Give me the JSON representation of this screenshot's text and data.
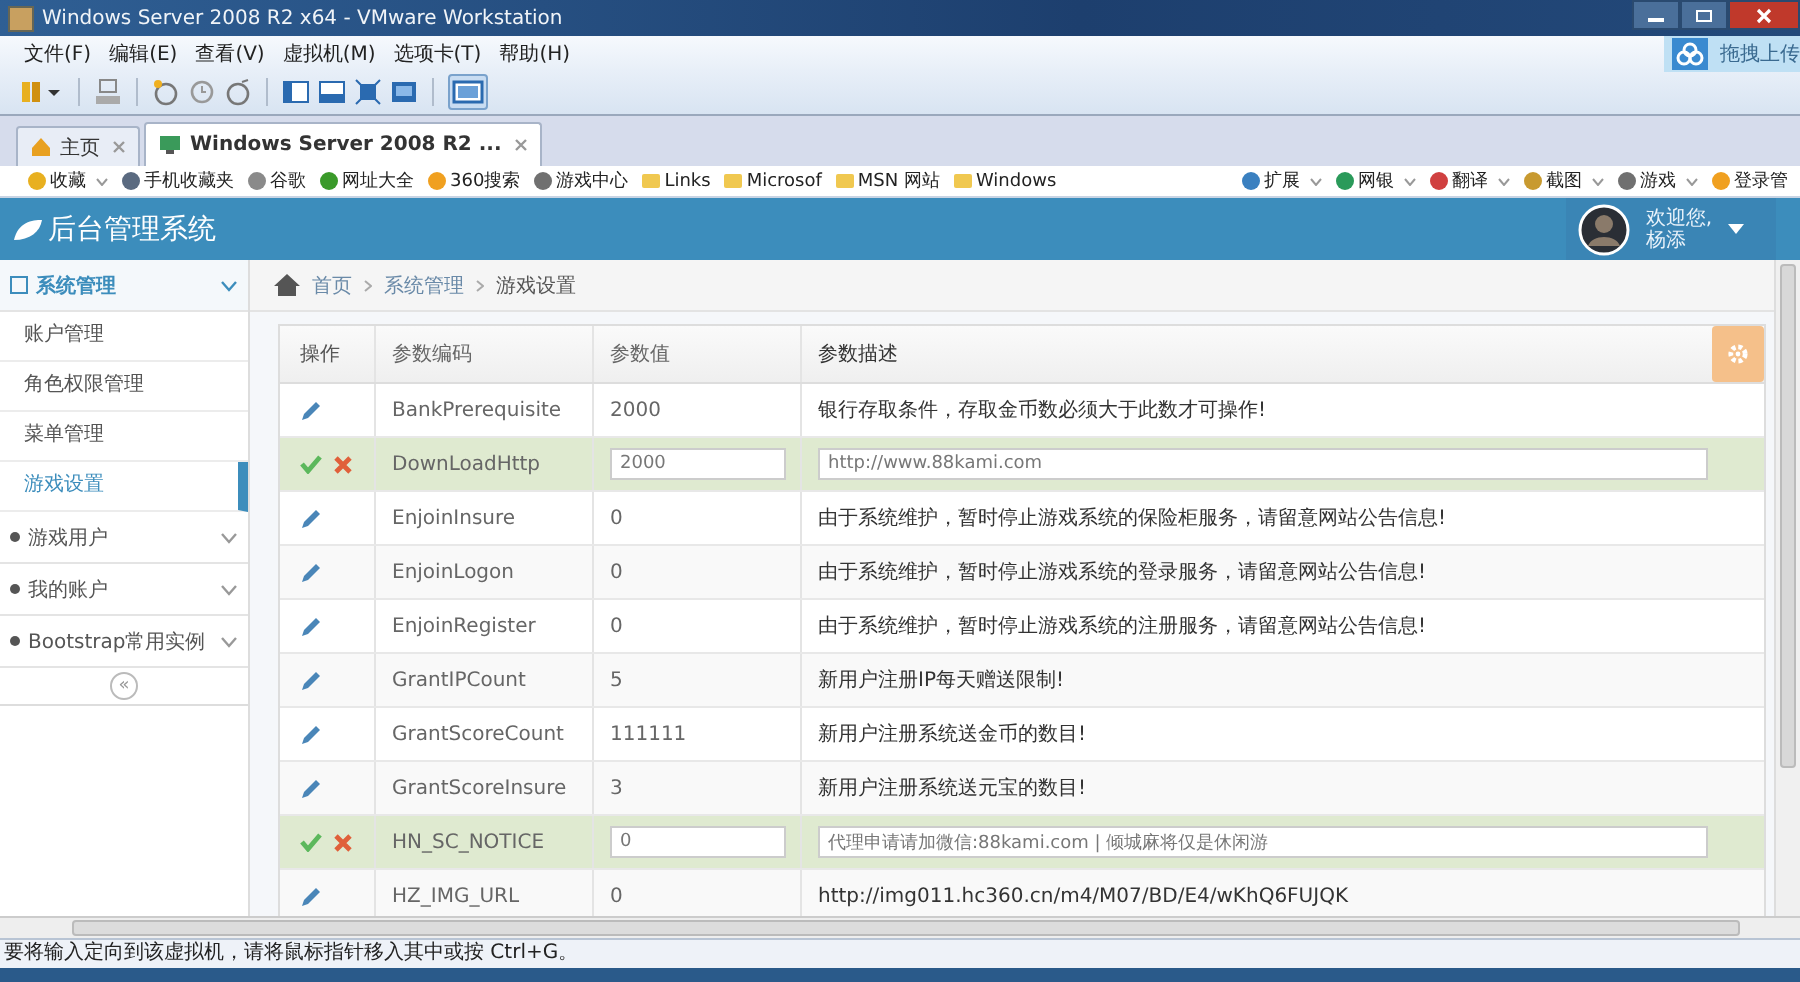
{
  "window": {
    "title": "Windows Server 2008 R2 x64 - VMware Workstation"
  },
  "upload_badge": {
    "label": "拖拽上传"
  },
  "menu_bar": [
    "文件(F)",
    "编辑(E)",
    "查看(V)",
    "虚拟机(M)",
    "选项卡(T)",
    "帮助(H)"
  ],
  "tabs": [
    {
      "label": "主页",
      "selected": false,
      "kind": "home"
    },
    {
      "label": "Windows Server 2008 R2 ...",
      "selected": true,
      "kind": "vm"
    }
  ],
  "favorites": [
    {
      "label": "收藏",
      "kind": "star",
      "dropdown": true
    },
    {
      "label": "手机收藏夹",
      "kind": "phone",
      "dropdown": false
    },
    {
      "label": "谷歌",
      "kind": "page",
      "dropdown": false
    },
    {
      "label": "网址大全",
      "kind": "globe",
      "dropdown": false
    },
    {
      "label": "360搜索",
      "kind": "search",
      "dropdown": false
    },
    {
      "label": "游戏中心",
      "kind": "game",
      "dropdown": false
    },
    {
      "label": "Links",
      "kind": "folder",
      "dropdown": false
    },
    {
      "label": "Microsof",
      "kind": "folder",
      "dropdown": false
    },
    {
      "label": "MSN 网站",
      "kind": "folder",
      "dropdown": false
    },
    {
      "label": "Windows",
      "kind": "folder",
      "dropdown": false
    }
  ],
  "favorites_right": [
    {
      "label": "扩展",
      "kind": "grid",
      "dropdown": true
    },
    {
      "label": "网银",
      "kind": "coin",
      "dropdown": true
    },
    {
      "label": "翻译",
      "kind": "translate",
      "dropdown": true
    },
    {
      "label": "截图",
      "kind": "scissors",
      "dropdown": true
    },
    {
      "label": "游戏",
      "kind": "game",
      "dropdown": true
    },
    {
      "label": "登录管",
      "kind": "search",
      "dropdown": false
    }
  ],
  "app": {
    "title": "后台管理系统",
    "greeting": "欢迎您,",
    "user": "杨添"
  },
  "sidebar": [
    {
      "label": "系统管理",
      "expanded": true,
      "children": [
        {
          "label": "账户管理",
          "selected": false
        },
        {
          "label": "角色权限管理",
          "selected": false
        },
        {
          "label": "菜单管理",
          "selected": false
        },
        {
          "label": "游戏设置",
          "selected": true
        }
      ]
    },
    {
      "label": "游戏用户",
      "expanded": false
    },
    {
      "label": "我的账户",
      "expanded": false
    },
    {
      "label": "Bootstrap常用实例",
      "expanded": false
    }
  ],
  "sidebar_collapse": "«",
  "breadcrumb": [
    "首页",
    "系统管理",
    "游戏设置"
  ],
  "table": {
    "columns": [
      "操作",
      "参数编码",
      "参数值",
      "参数描述"
    ],
    "rows": [
      {
        "kind": "view",
        "code": "BankPrerequisite",
        "value": "2000",
        "description": "银行存取条件，存取金币数必须大于此数才可操作!"
      },
      {
        "kind": "edit",
        "code": "DownLoadHttp",
        "value": "2000",
        "description": "http://www.88kami.com"
      },
      {
        "kind": "view",
        "code": "EnjoinInsure",
        "value": "0",
        "description": "由于系统维护，暂时停止游戏系统的保险柜服务，请留意网站公告信息!"
      },
      {
        "kind": "view",
        "code": "EnjoinLogon",
        "value": "0",
        "description": "由于系统维护，暂时停止游戏系统的登录服务，请留意网站公告信息!"
      },
      {
        "kind": "view",
        "code": "EnjoinRegister",
        "value": "0",
        "description": "由于系统维护，暂时停止游戏系统的注册服务，请留意网站公告信息!"
      },
      {
        "kind": "view",
        "code": "GrantIPCount",
        "value": "5",
        "description": "新用户注册IP每天赠送限制!"
      },
      {
        "kind": "view",
        "code": "GrantScoreCount",
        "value": "111111",
        "description": "新用户注册系统送金币的数目!"
      },
      {
        "kind": "view",
        "code": "GrantScoreInsure",
        "value": "3",
        "description": "新用户注册系统送元宝的数目!"
      },
      {
        "kind": "edit",
        "code": "HN_SC_NOTICE",
        "value": "0",
        "description": "代理申请请加微信:88kami.com | 倾城麻将仅是休闲游"
      },
      {
        "kind": "view",
        "code": "HZ_IMG_URL",
        "value": "0",
        "description": "http://img011.hc360.cn/m4/M07/BD/E4/wKhQ6FUJQK"
      }
    ]
  },
  "status_bar": "要将输入定向到该虚拟机，请将鼠标指针移入其中或按 Ctrl+G。"
}
